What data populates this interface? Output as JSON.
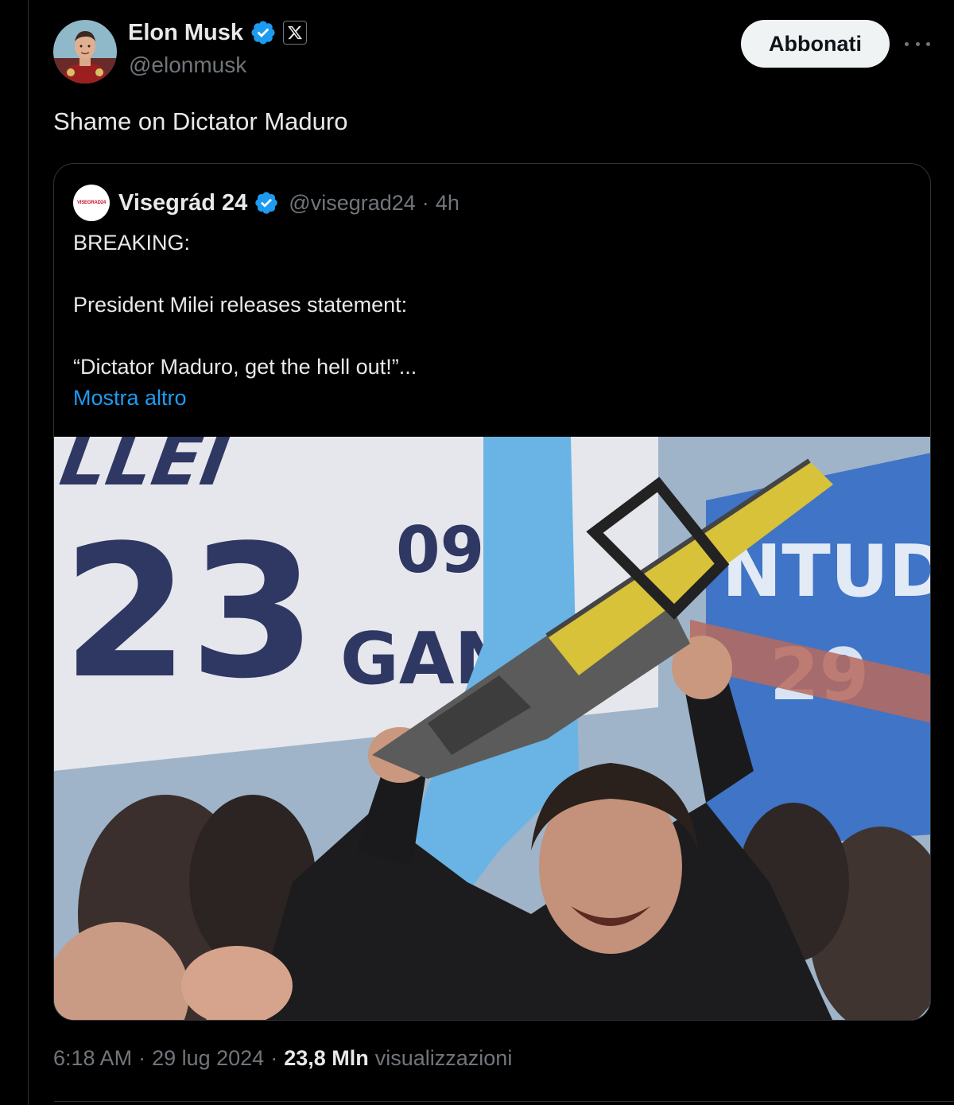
{
  "tweet": {
    "author": {
      "name": "Elon Musk",
      "handle": "@elonmusk",
      "verified": true,
      "affiliation_icon": "x-logo-icon"
    },
    "follow_button_label": "Abbonati",
    "more_icon": "more-horizontal-icon",
    "text": "Shame on Dictator Maduro",
    "quote": {
      "author": {
        "name": "Visegrád 24",
        "handle": "@visegrad24",
        "separator": "·",
        "time": "4h",
        "logo_text": "VISEGRAD24",
        "verified": true
      },
      "lines": [
        "BREAKING:",
        "President Milei releases statement:",
        "“Dictator Maduro, get the hell out!”..."
      ],
      "show_more_label": "Mostra altro",
      "image_icon": "photo-icon"
    },
    "footer": {
      "time": "6:18 AM",
      "sep1": "·",
      "date": "29 lug 2024",
      "sep2": "·",
      "views_count": "23,8 Mln",
      "views_label": "visualizzazioni"
    }
  },
  "colors": {
    "background": "#000000",
    "text_primary": "#e7e9ea",
    "text_secondary": "#71767b",
    "link": "#1d9bf0",
    "verified_badge": "#1d9bf0",
    "border": "#2f3336",
    "follow_button_bg": "#eff3f4"
  }
}
